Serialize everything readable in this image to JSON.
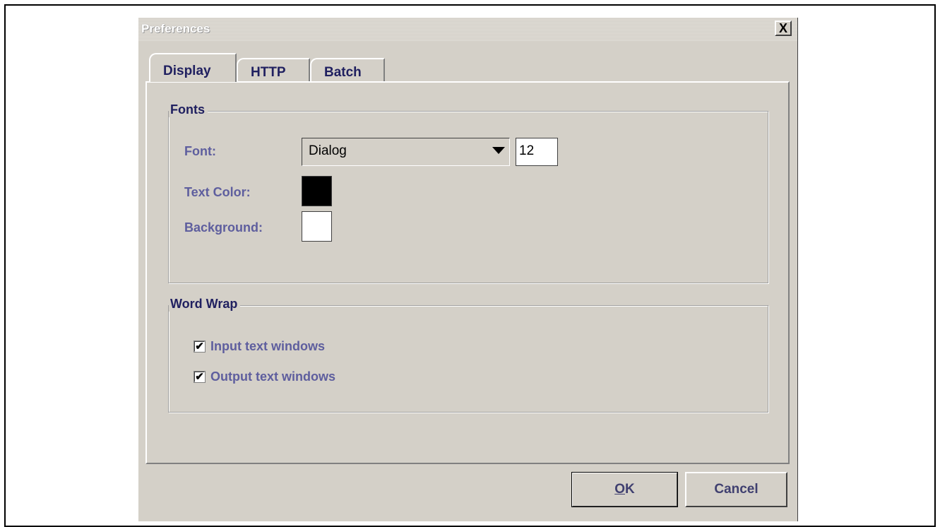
{
  "dialog": {
    "title": "Preferences",
    "close_glyph": "X"
  },
  "tabs": [
    {
      "label": "Display",
      "active": true
    },
    {
      "label": "HTTP",
      "active": false
    },
    {
      "label": "Batch",
      "active": false
    }
  ],
  "fonts_group": {
    "title": "Fonts",
    "font_label": "Font:",
    "font_value": "Dialog",
    "font_size": "12",
    "text_color_label": "Text Color:",
    "text_color": "#000000",
    "background_label": "Background:",
    "background_color": "#ffffff"
  },
  "wordwrap_group": {
    "title": "Word Wrap",
    "options": [
      {
        "label": "Input text windows",
        "checked": true
      },
      {
        "label": "Output text windows",
        "checked": true
      }
    ]
  },
  "buttons": {
    "ok_mnemonic": "O",
    "ok_rest": "K",
    "cancel_label": "Cancel"
  },
  "icons": {
    "dropdown": "chevron-down-icon",
    "check": "check-icon"
  },
  "colors": {
    "window_bg": "#d4d0c8",
    "label_text": "#5e5e9e",
    "heading_text": "#202060"
  }
}
